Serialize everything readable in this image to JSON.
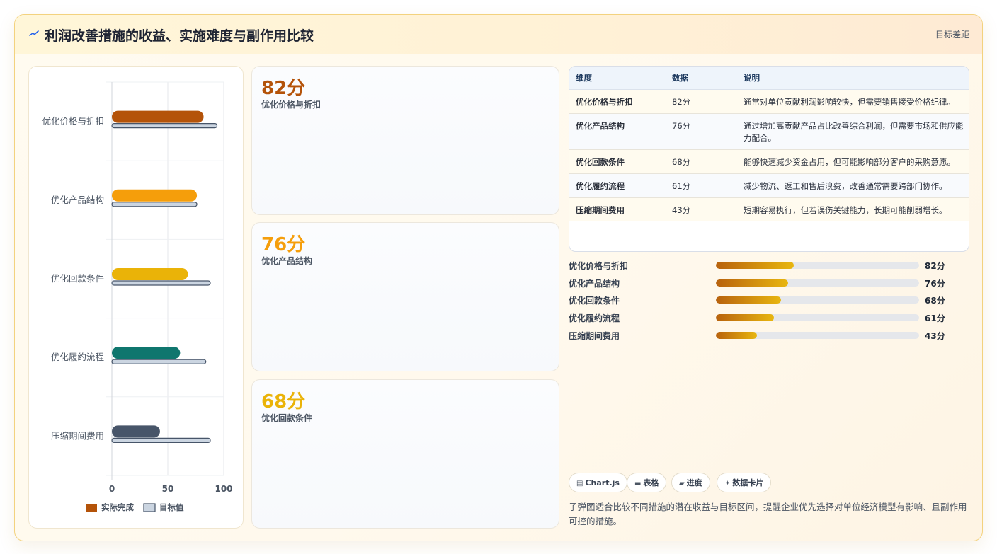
{
  "header": {
    "title": "利润改善措施的收益、实施难度与副作用比较",
    "link_label": "目标差距"
  },
  "colors": {
    "accent_1": "#b45309",
    "accent_2": "#f59e0b",
    "accent_3": "#eab308",
    "accent_4": "#0f766e",
    "accent_5": "#475569",
    "target": "#cbd5e1"
  },
  "chart_data": {
    "type": "bar",
    "orientation": "horizontal",
    "categories": [
      "优化价格与折扣",
      "优化产品结构",
      "优化回款条件",
      "优化履约流程",
      "压缩期间费用"
    ],
    "series": [
      {
        "name": "实际完成",
        "values": [
          82,
          76,
          68,
          61,
          43
        ]
      },
      {
        "name": "目标值",
        "values": [
          94,
          76,
          88,
          84,
          88
        ]
      }
    ],
    "xlim": [
      0,
      100
    ],
    "x_ticks": [
      "0",
      "50",
      "100"
    ],
    "grid": true,
    "legend_position": "bottom"
  },
  "stat_cards": [
    {
      "value": "82分",
      "label": "优化价格与折扣",
      "color": "#b45309"
    },
    {
      "value": "76分",
      "label": "优化产品结构",
      "color": "#f59e0b"
    },
    {
      "value": "68分",
      "label": "优化回款条件",
      "color": "#eab308"
    }
  ],
  "table": {
    "headers": [
      "维度",
      "数据",
      "说明"
    ],
    "rows": [
      {
        "dim": "优化价格与折扣",
        "data": "82分",
        "note": "通常对单位贡献利润影响较快，但需要销售接受价格纪律。"
      },
      {
        "dim": "优化产品结构",
        "data": "76分",
        "note": "通过增加高贡献产品占比改善综合利润，但需要市场和供应能力配合。"
      },
      {
        "dim": "优化回款条件",
        "data": "68分",
        "note": "能够快速减少资金占用，但可能影响部分客户的采购意愿。"
      },
      {
        "dim": "优化履约流程",
        "data": "61分",
        "note": "减少物流、返工和售后浪费，改善通常需要跨部门协作。"
      },
      {
        "dim": "压缩期间费用",
        "data": "43分",
        "note": "短期容易执行，但若误伤关键能力，长期可能削弱增长。"
      }
    ]
  },
  "progress": [
    {
      "label": "优化价格与折扣",
      "value_text": "82分",
      "fraction": 0.385
    },
    {
      "label": "优化产品结构",
      "value_text": "76分",
      "fraction": 0.357
    },
    {
      "label": "优化回款条件",
      "value_text": "68分",
      "fraction": 0.32
    },
    {
      "label": "优化履约流程",
      "value_text": "61分",
      "fraction": 0.286
    },
    {
      "label": "压缩期间费用",
      "value_text": "43分",
      "fraction": 0.202
    }
  ],
  "tags": [
    {
      "icon": "▤",
      "label": "Chart.js"
    },
    {
      "icon": "▬",
      "label": "表格"
    },
    {
      "icon": "▰",
      "label": "进度"
    },
    {
      "icon": "✦",
      "label": "数据卡片"
    }
  ],
  "description": "子弹图适合比较不同措施的潜在收益与目标区间，提醒企业优先选择对单位经济模型有影响、且副作用可控的措施。"
}
